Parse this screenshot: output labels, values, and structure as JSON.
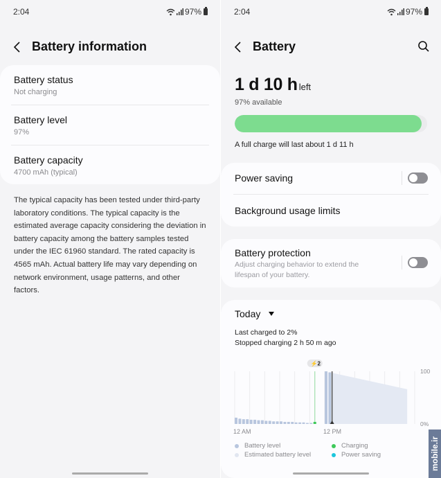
{
  "status_bar": {
    "time": "2:04",
    "battery_percent": "97%"
  },
  "left_screen": {
    "title": "Battery information",
    "rows": [
      {
        "title": "Battery status",
        "value": "Not charging"
      },
      {
        "title": "Battery level",
        "value": "97%"
      },
      {
        "title": "Battery capacity",
        "value": "4700 mAh (typical)"
      }
    ],
    "description": "The typical capacity has been tested under third-party laboratory conditions. The typical capacity is the estimated average capacity considering the deviation in battery capacity among the battery samples tested under the IEC 61960 standard. The rated capacity is 4565 mAh. Actual battery life may vary depending on network environment, usage patterns, and other factors."
  },
  "right_screen": {
    "title": "Battery",
    "time_left_value": "1 d 10 h",
    "time_left_suffix": "left",
    "available": "97% available",
    "level_percent": 97,
    "full_charge": "A full charge will last about 1 d 11 h",
    "power_saving": {
      "label": "Power saving",
      "enabled": false
    },
    "background_limits": {
      "label": "Background usage limits"
    },
    "battery_protection": {
      "label": "Battery protection",
      "description": "Adjust charging behavior to extend the lifespan of your battery.",
      "enabled": false
    },
    "usage": {
      "period": "Today",
      "last_charged": "Last charged to 2%",
      "stopped_charging": "Stopped charging 2 h 50 m ago",
      "charge_badge": "2",
      "x_labels": [
        "12 AM",
        "12 PM"
      ],
      "y_labels": [
        "100",
        "0%"
      ],
      "legend": [
        {
          "label": "Battery level",
          "color": "#b8c6de"
        },
        {
          "label": "Estimated battery level",
          "color": "#e1e6f0"
        },
        {
          "label": "Charging",
          "color": "#3ec95a"
        },
        {
          "label": "Power saving",
          "color": "#1cc6dc"
        }
      ]
    }
  },
  "chart_data": {
    "type": "bar",
    "title": "Today",
    "xlabel": "",
    "ylabel": "",
    "x_tick_labels": [
      "12 AM",
      "12 PM"
    ],
    "ylim": [
      0,
      100
    ],
    "y_tick_labels": [
      "100",
      "0%"
    ],
    "grid": true,
    "hours_shown": 24,
    "series": [
      {
        "name": "Battery level",
        "hours": [
          0,
          0.5,
          1,
          1.5,
          2,
          2.5,
          3,
          3.5,
          4,
          4.5,
          5,
          5.5,
          6,
          6.5,
          7,
          7.5,
          8,
          8.5,
          9,
          9.5,
          10,
          10.5,
          11,
          11.5,
          12,
          12.5
        ],
        "values": [
          12,
          10,
          9,
          9,
          8,
          8,
          7,
          7,
          6,
          6,
          5,
          5,
          5,
          4,
          4,
          4,
          3,
          3,
          3,
          2,
          2,
          2,
          null,
          null,
          100,
          98
        ]
      },
      {
        "name": "Estimated battery level",
        "hours": [
          13,
          23
        ],
        "values": [
          97,
          66
        ]
      },
      {
        "name": "Charging",
        "hours": [
          10.5
        ],
        "values": [
          2
        ]
      }
    ],
    "annotations": [
      "Charged to 2% at ~10:30",
      "Current time marker ~12:50"
    ]
  },
  "watermark": "mobile.ir"
}
